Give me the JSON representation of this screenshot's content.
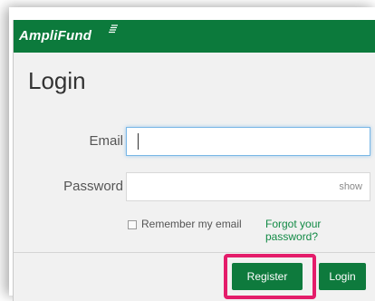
{
  "header": {
    "brand": "AmpliFund"
  },
  "form": {
    "title": "Login",
    "email_label": "Email",
    "email_value": "",
    "password_label": "Password",
    "password_value": "",
    "show_label": "show",
    "remember_label": "Remember my email",
    "remember_checked": false,
    "forgot_label": "Forgot your password?"
  },
  "footer": {
    "register_label": "Register",
    "login_label": "Login"
  },
  "colors": {
    "brand_green": "#0c7a3c",
    "highlight": "#e41c6a",
    "link": "#128a45"
  },
  "icons": {
    "brand_mark": "stripes-logo-icon"
  }
}
